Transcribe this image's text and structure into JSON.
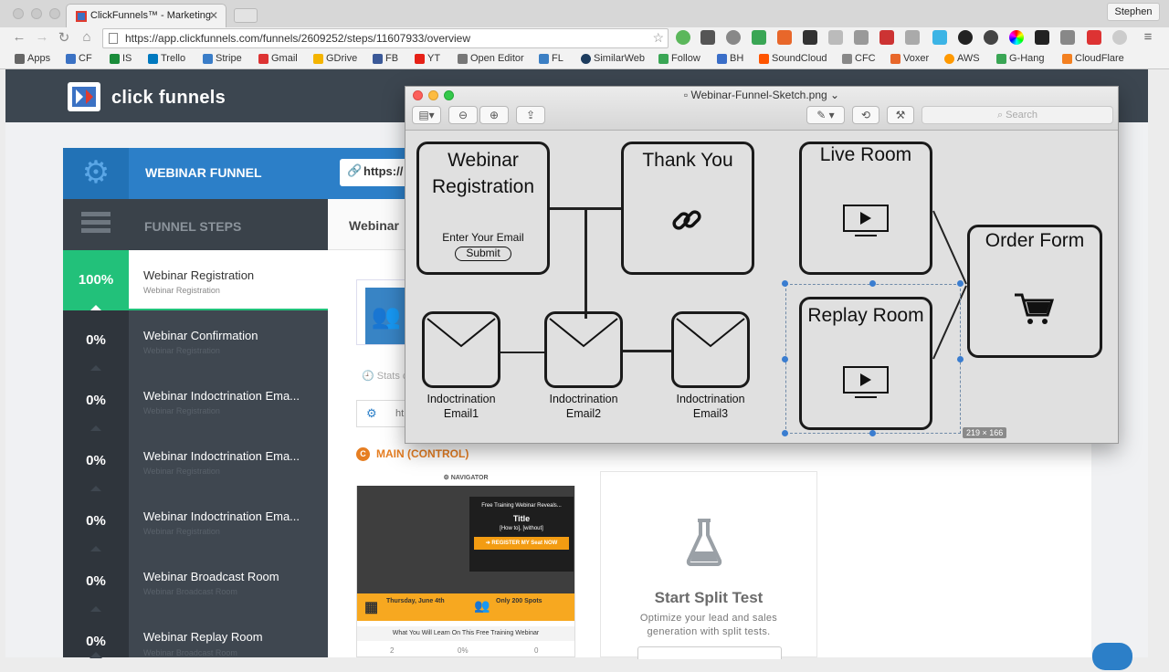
{
  "browser": {
    "tab_title": "ClickFunnels™ - Marketing",
    "profile": "Stephen",
    "url": "https://app.clickfunnels.com/funnels/2609252/steps/11607933/overview",
    "bookmarks": [
      "Apps",
      "CF",
      "IS",
      "Trello",
      "Stripe",
      "Gmail",
      "GDrive",
      "FB",
      "YT",
      "Open Editor",
      "FL",
      "SimilarWeb",
      "Follow",
      "BH",
      "SoundCloud",
      "CFC",
      "Voxer",
      "AWS",
      "G-Hang",
      "CloudFlare"
    ]
  },
  "cf": {
    "logo": "click funnels",
    "funnel_title": "WEBINAR FUNNEL",
    "funnel_url": "https://",
    "steps_header": "FUNNEL STEPS",
    "main_header": "Webinar",
    "stats_text": "Stats c",
    "url_field": "ht",
    "main_control": "MAIN (CONTROL)",
    "steps": [
      {
        "pct": "100%",
        "name": "Webinar Registration",
        "sub": "Webinar Registration"
      },
      {
        "pct": "0%",
        "name": "Webinar Confirmation",
        "sub": "Webinar Registration"
      },
      {
        "pct": "0%",
        "name": "Webinar Indoctrination Ema...",
        "sub": "Webinar Registration"
      },
      {
        "pct": "0%",
        "name": "Webinar Indoctrination Ema...",
        "sub": "Webinar Registration"
      },
      {
        "pct": "0%",
        "name": "Webinar Indoctrination Ema...",
        "sub": "Webinar Registration"
      },
      {
        "pct": "0%",
        "name": "Webinar Broadcast Room",
        "sub": "Webinar Broadcast Room"
      },
      {
        "pct": "0%",
        "name": "Webinar Replay Room",
        "sub": "Webinar Broadcast Room"
      }
    ],
    "thumb": {
      "nav": "NAVIGATOR",
      "card_pre": "Free Training Webinar Reveals...",
      "card_title": "Title",
      "card_sub": "[How to], [without]",
      "card_btn": "➔ REGISTER MY Seat NOW",
      "date": "Thursday, June 4th",
      "spots": "Only 200 Spots",
      "learn": "What You Will Learn On This Free Training Webinar",
      "stats": [
        "2",
        "0%",
        "0"
      ]
    },
    "split": {
      "title": "Start Split Test",
      "desc": "Optimize your lead and sales generation with split tests."
    }
  },
  "preview": {
    "title": "Webinar-Funnel-Sketch.png",
    "search_placeholder": "Search",
    "sketch": {
      "registration": "Webinar Registration",
      "email_prompt": "Enter Your Email",
      "submit": "Submit",
      "thank_you": "Thank You",
      "live_room": "Live Room",
      "replay_room": "Replay Room",
      "order_form": "Order Form",
      "emails": [
        "Indoctrination Email1",
        "Indoctrination Email2",
        "Indoctrination Email3"
      ],
      "selection_size": "219 × 166"
    }
  },
  "colors": {
    "cf_blue": "#2c7fc8",
    "cf_green": "#22c17a",
    "cf_orange": "#e67e22",
    "sidebar": "#3f4750"
  }
}
